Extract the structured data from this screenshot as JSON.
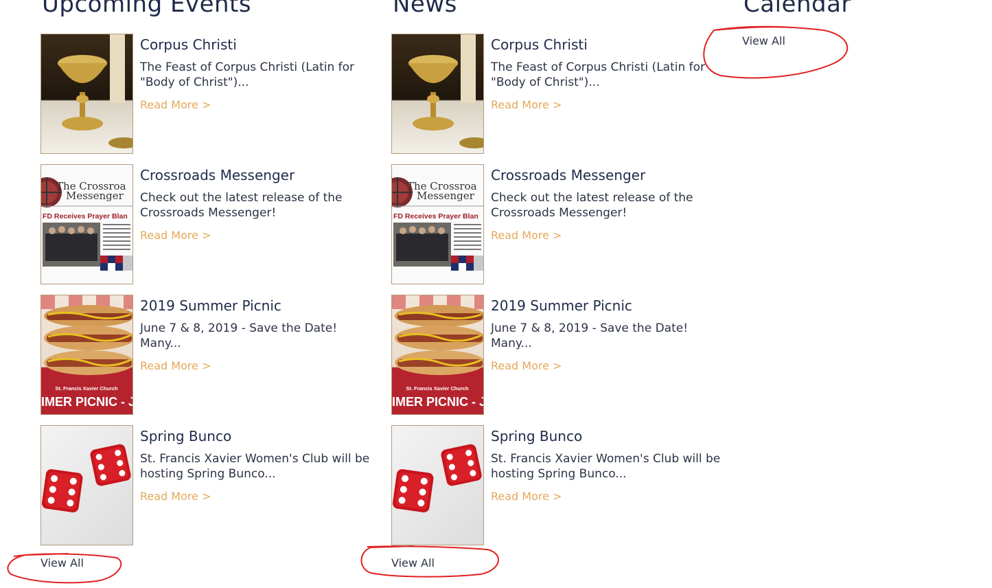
{
  "events": {
    "title": "Upcoming Events",
    "view_all": "View All",
    "items": [
      {
        "title": "Corpus Christi",
        "excerpt": "The Feast of Corpus Christi (Latin for \"Body of Christ\")...",
        "read_more": "Read More >"
      },
      {
        "title": "Crossroads Messenger",
        "excerpt": "Check out the latest release of the Crossroads Messenger!",
        "read_more": "Read More >"
      },
      {
        "title": "2019 Summer Picnic",
        "excerpt": "June 7 & 8, 2019 - Save the Date! Many...",
        "read_more": "Read More >"
      },
      {
        "title": "Spring Bunco",
        "excerpt": "St. Francis Xavier Women's Club will be hosting Spring Bunco...",
        "read_more": "Read More >"
      }
    ]
  },
  "news": {
    "title": "News",
    "view_all": "View All",
    "items": [
      {
        "title": "Corpus Christi",
        "excerpt": "The Feast of Corpus Christi (Latin for \"Body of Christ\")...",
        "read_more": "Read More >"
      },
      {
        "title": "Crossroads Messenger",
        "excerpt": "Check out the latest release of the Crossroads Messenger!",
        "read_more": "Read More >"
      },
      {
        "title": "2019 Summer Picnic",
        "excerpt": "June 7 & 8, 2019 - Save the Date! Many...",
        "read_more": "Read More >"
      },
      {
        "title": "Spring Bunco",
        "excerpt": "St. Francis Xavier Women's Club will be hosting Spring Bunco...",
        "read_more": "Read More >"
      }
    ]
  },
  "calendar": {
    "title": "Calendar",
    "view_all": "View All"
  },
  "thumb_text": {
    "crossroads_line1": "The Crossroa",
    "crossroads_line2": "Messenger",
    "crossroads_headline": "FD Receives Prayer Blan",
    "picnic_line1": "St. Francis Xavier Church",
    "picnic_line2": "IMER PICNIC - JU"
  },
  "colors": {
    "heading": "#1f2a4a",
    "read_more": "#e4a85a",
    "annotation_circle": "#e02020",
    "thumb_border": "#b49a7c"
  }
}
